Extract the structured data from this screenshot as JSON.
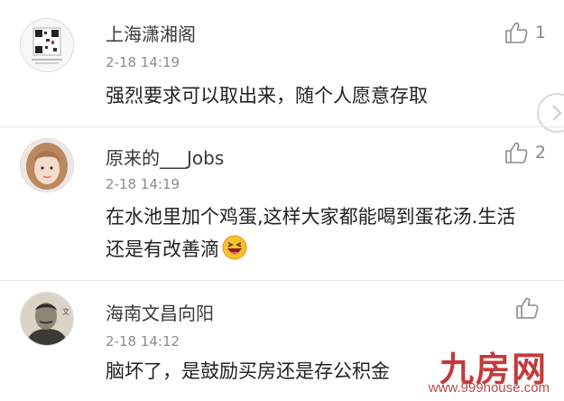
{
  "comments": [
    {
      "username": "上海潇湘阁",
      "timestamp": "2-18 14:19",
      "text": "强烈要求可以取出来，随个人愿意存取",
      "likes": "1"
    },
    {
      "username": "原来的___Jobs",
      "timestamp": "2-18 14:19",
      "text": "在水池里加个鸡蛋,这样大家都能喝到蛋花汤.生活还是有改善滴",
      "likes": "2"
    },
    {
      "username": "海南文昌向阳",
      "timestamp": "2-18 14:12",
      "text": "脑坏了，是鼓励买房还是存公积金",
      "likes": ""
    }
  ],
  "watermark": {
    "logo": "九房网",
    "url": "www.999house.com"
  },
  "colors": {
    "like_icon": "#8a8a8a",
    "watermark": "#c23b3b",
    "divider": "#e7e7e7"
  }
}
